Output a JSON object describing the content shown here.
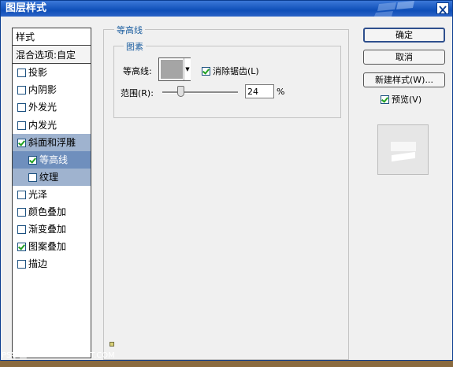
{
  "window": {
    "title": "图层样式"
  },
  "style_list": {
    "header": "样式",
    "blend_options": "混合选项:自定",
    "items": [
      {
        "label": "投影",
        "checked": false
      },
      {
        "label": "内阴影",
        "checked": false
      },
      {
        "label": "外发光",
        "checked": false
      },
      {
        "label": "内发光",
        "checked": false
      },
      {
        "label": "斜面和浮雕",
        "checked": true
      },
      {
        "label": "等高线",
        "checked": true
      },
      {
        "label": "纹理",
        "checked": false
      },
      {
        "label": "光泽",
        "checked": false
      },
      {
        "label": "颜色叠加",
        "checked": false
      },
      {
        "label": "渐变叠加",
        "checked": false
      },
      {
        "label": "图案叠加",
        "checked": true
      },
      {
        "label": "描边",
        "checked": false
      }
    ]
  },
  "contour_panel": {
    "group_title": "等高线",
    "subgroup_title": "图素",
    "contour_label": "等高线:",
    "antialias_label": "消除锯齿(L)",
    "antialias_checked": true,
    "range_label": "范围(R):",
    "range_value": "24",
    "range_percent": 24,
    "range_unit": "%"
  },
  "buttons": {
    "ok": "确定",
    "cancel": "取消",
    "new_style": "新建样式(W)...",
    "preview_label": "预览(V)",
    "preview_checked": true
  },
  "watermark": "PS学堂 — WWW.52PSXT.COM"
}
